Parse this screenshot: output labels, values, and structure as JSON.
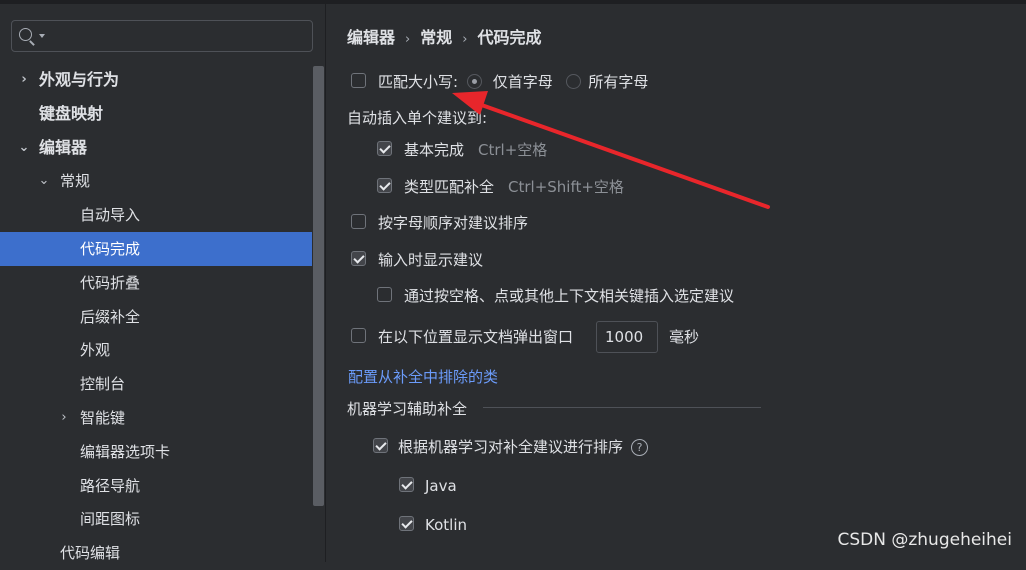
{
  "search": {
    "placeholder": ""
  },
  "tree": [
    {
      "id": "appearance",
      "label": "外观与行为",
      "arrow": "›",
      "bold": true
    },
    {
      "id": "keymap",
      "label": "键盘映射",
      "bold": true
    },
    {
      "id": "editor",
      "label": "编辑器",
      "arrow": "⌄",
      "bold": true
    },
    {
      "id": "general",
      "label": "常规",
      "arrow": "⌄"
    },
    {
      "id": "auto-import",
      "label": "自动导入"
    },
    {
      "id": "code-completion",
      "label": "代码完成",
      "selected": true
    },
    {
      "id": "code-folding",
      "label": "代码折叠"
    },
    {
      "id": "postfix",
      "label": "后缀补全"
    },
    {
      "id": "appearance-sub",
      "label": "外观"
    },
    {
      "id": "console",
      "label": "控制台"
    },
    {
      "id": "smart-keys",
      "label": "智能键",
      "arrow": "›"
    },
    {
      "id": "editor-tabs",
      "label": "编辑器选项卡"
    },
    {
      "id": "breadcrumbs",
      "label": "路径导航"
    },
    {
      "id": "gutter-icons",
      "label": "间距图标"
    },
    {
      "id": "code-editing",
      "label": "代码编辑"
    }
  ],
  "breadcrumb": {
    "part1": "编辑器",
    "part2": "常规",
    "part3": "代码完成",
    "sep": "›"
  },
  "settings": {
    "match_case": {
      "label": "匹配大小写:",
      "checked": false
    },
    "radio_first": {
      "label": "仅首字母",
      "selected": true
    },
    "radio_all": {
      "label": "所有字母",
      "selected": false
    },
    "auto_insert_heading": "自动插入单个建议到:",
    "basic": {
      "label": "基本完成",
      "shortcut": "Ctrl+空格",
      "checked": true
    },
    "smart_type": {
      "label": "类型匹配补全",
      "shortcut": "Ctrl+Shift+空格",
      "checked": true
    },
    "sort_alpha": {
      "label": "按字母顺序对建议排序",
      "checked": false
    },
    "show_on_typing": {
      "label": "输入时显示建议",
      "checked": true
    },
    "insert_on_space": {
      "label": "通过按空格、点或其他上下文相关键插入选定建议",
      "checked": false
    },
    "show_doc": {
      "label": "在以下位置显示文档弹出窗口",
      "value": "1000",
      "unit": "毫秒",
      "checked": false
    },
    "exclude_link": "配置从补全中排除的类",
    "ml_group": "机器学习辅助补全",
    "ml_sort": {
      "label": "根据机器学习对补全建议进行排序",
      "help": "?",
      "checked": true
    },
    "ml_java": {
      "label": "Java",
      "checked": true
    },
    "ml_kotlin": {
      "label": "Kotlin",
      "checked": true
    }
  },
  "watermark": "CSDN @zhugeheihei",
  "colors": {
    "selection": "#3d6fcc",
    "link": "#6b9bfa",
    "annotation_arrow": "#e8262b"
  }
}
